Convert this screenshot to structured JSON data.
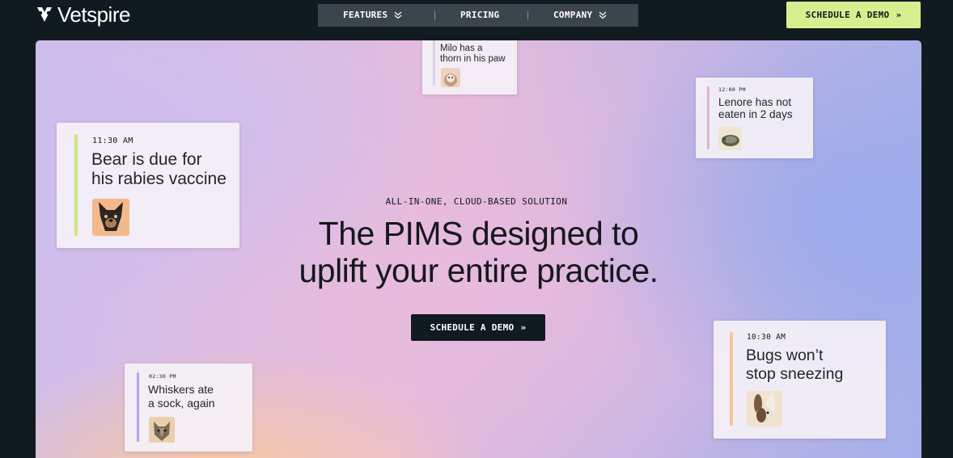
{
  "brand": {
    "name": "Vetspire"
  },
  "nav": {
    "items": [
      {
        "label": "FEATURES"
      },
      {
        "label": "PRICING"
      },
      {
        "label": "COMPANY"
      }
    ],
    "separator": "|"
  },
  "header_cta": {
    "label": "SCHEDULE A DEMO",
    "arrow": "»"
  },
  "hero": {
    "eyebrow": "ALL-IN-ONE, CLOUD-BASED SOLUTION",
    "headline_line1": "The PIMS designed to",
    "headline_line2": "uplift your entire practice.",
    "cta_label": "SCHEDULE A DEMO",
    "cta_arrow": "»"
  },
  "cards": {
    "bear": {
      "time": "11:30 AM",
      "line1": "Bear is due for",
      "line2": "his rabies vaccine",
      "accent": "#cde57f"
    },
    "milo": {
      "line1": "Milo has a",
      "line2": "thorn in his paw"
    },
    "lenore": {
      "time": "12:00 PM",
      "line1": "Lenore has not",
      "line2": "eaten in 2 days",
      "accent": "#e0b4c9"
    },
    "whiskers": {
      "time": "02:30 PM",
      "line1": "Whiskers ate",
      "line2": "a sock, again",
      "accent": "#a9a8ee"
    },
    "bugs": {
      "time": "10:30 AM",
      "line1": "Bugs won’t",
      "line2": "stop sneezing",
      "accent": "#f5c597"
    }
  },
  "colors": {
    "page_bg": "#111a1f",
    "nav_bg": "#3d454c",
    "cta_green": "#d9ef8f",
    "text_dark": "#14181c"
  }
}
